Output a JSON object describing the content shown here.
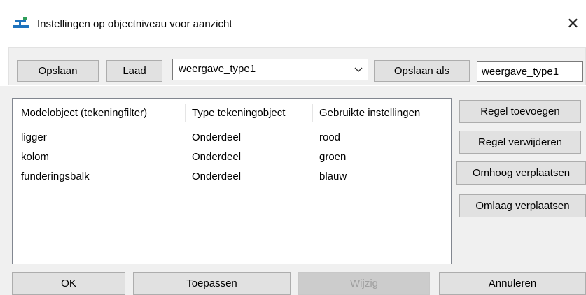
{
  "window": {
    "title": "Instellingen op objectniveau voor aanzicht",
    "close_glyph": "✕"
  },
  "toolbar": {
    "save_label": "Opslaan",
    "load_label": "Laad",
    "combo_value": "weergave_type1",
    "save_as_label": "Opslaan als",
    "save_as_name": "weergave_type1"
  },
  "list": {
    "columns": [
      "Modelobject (tekeningfilter)",
      "Type tekeningobject",
      "Gebruikte instellingen"
    ],
    "rows": [
      [
        "ligger",
        "Onderdeel",
        "rood"
      ],
      [
        "kolom",
        "Onderdeel",
        "groen"
      ],
      [
        "funderingsbalk",
        "Onderdeel",
        "blauw"
      ]
    ]
  },
  "side_buttons": {
    "add_rule": "Regel toevoegen",
    "remove_rule": "Regel verwijderen",
    "move_up": "Omhoog verplaatsen",
    "move_down": "Omlaag verplaatsen"
  },
  "footer": {
    "ok": "OK",
    "apply": "Toepassen",
    "modify": "Wijzig",
    "cancel": "Annuleren"
  },
  "icons": {
    "app": "view-settings-icon",
    "combo": "chevron-down-icon",
    "close": "close-icon"
  },
  "colors": {
    "accent": "#1e73be",
    "button_face": "#e1e1e1",
    "dialog_bg": "#f0f0f0"
  }
}
